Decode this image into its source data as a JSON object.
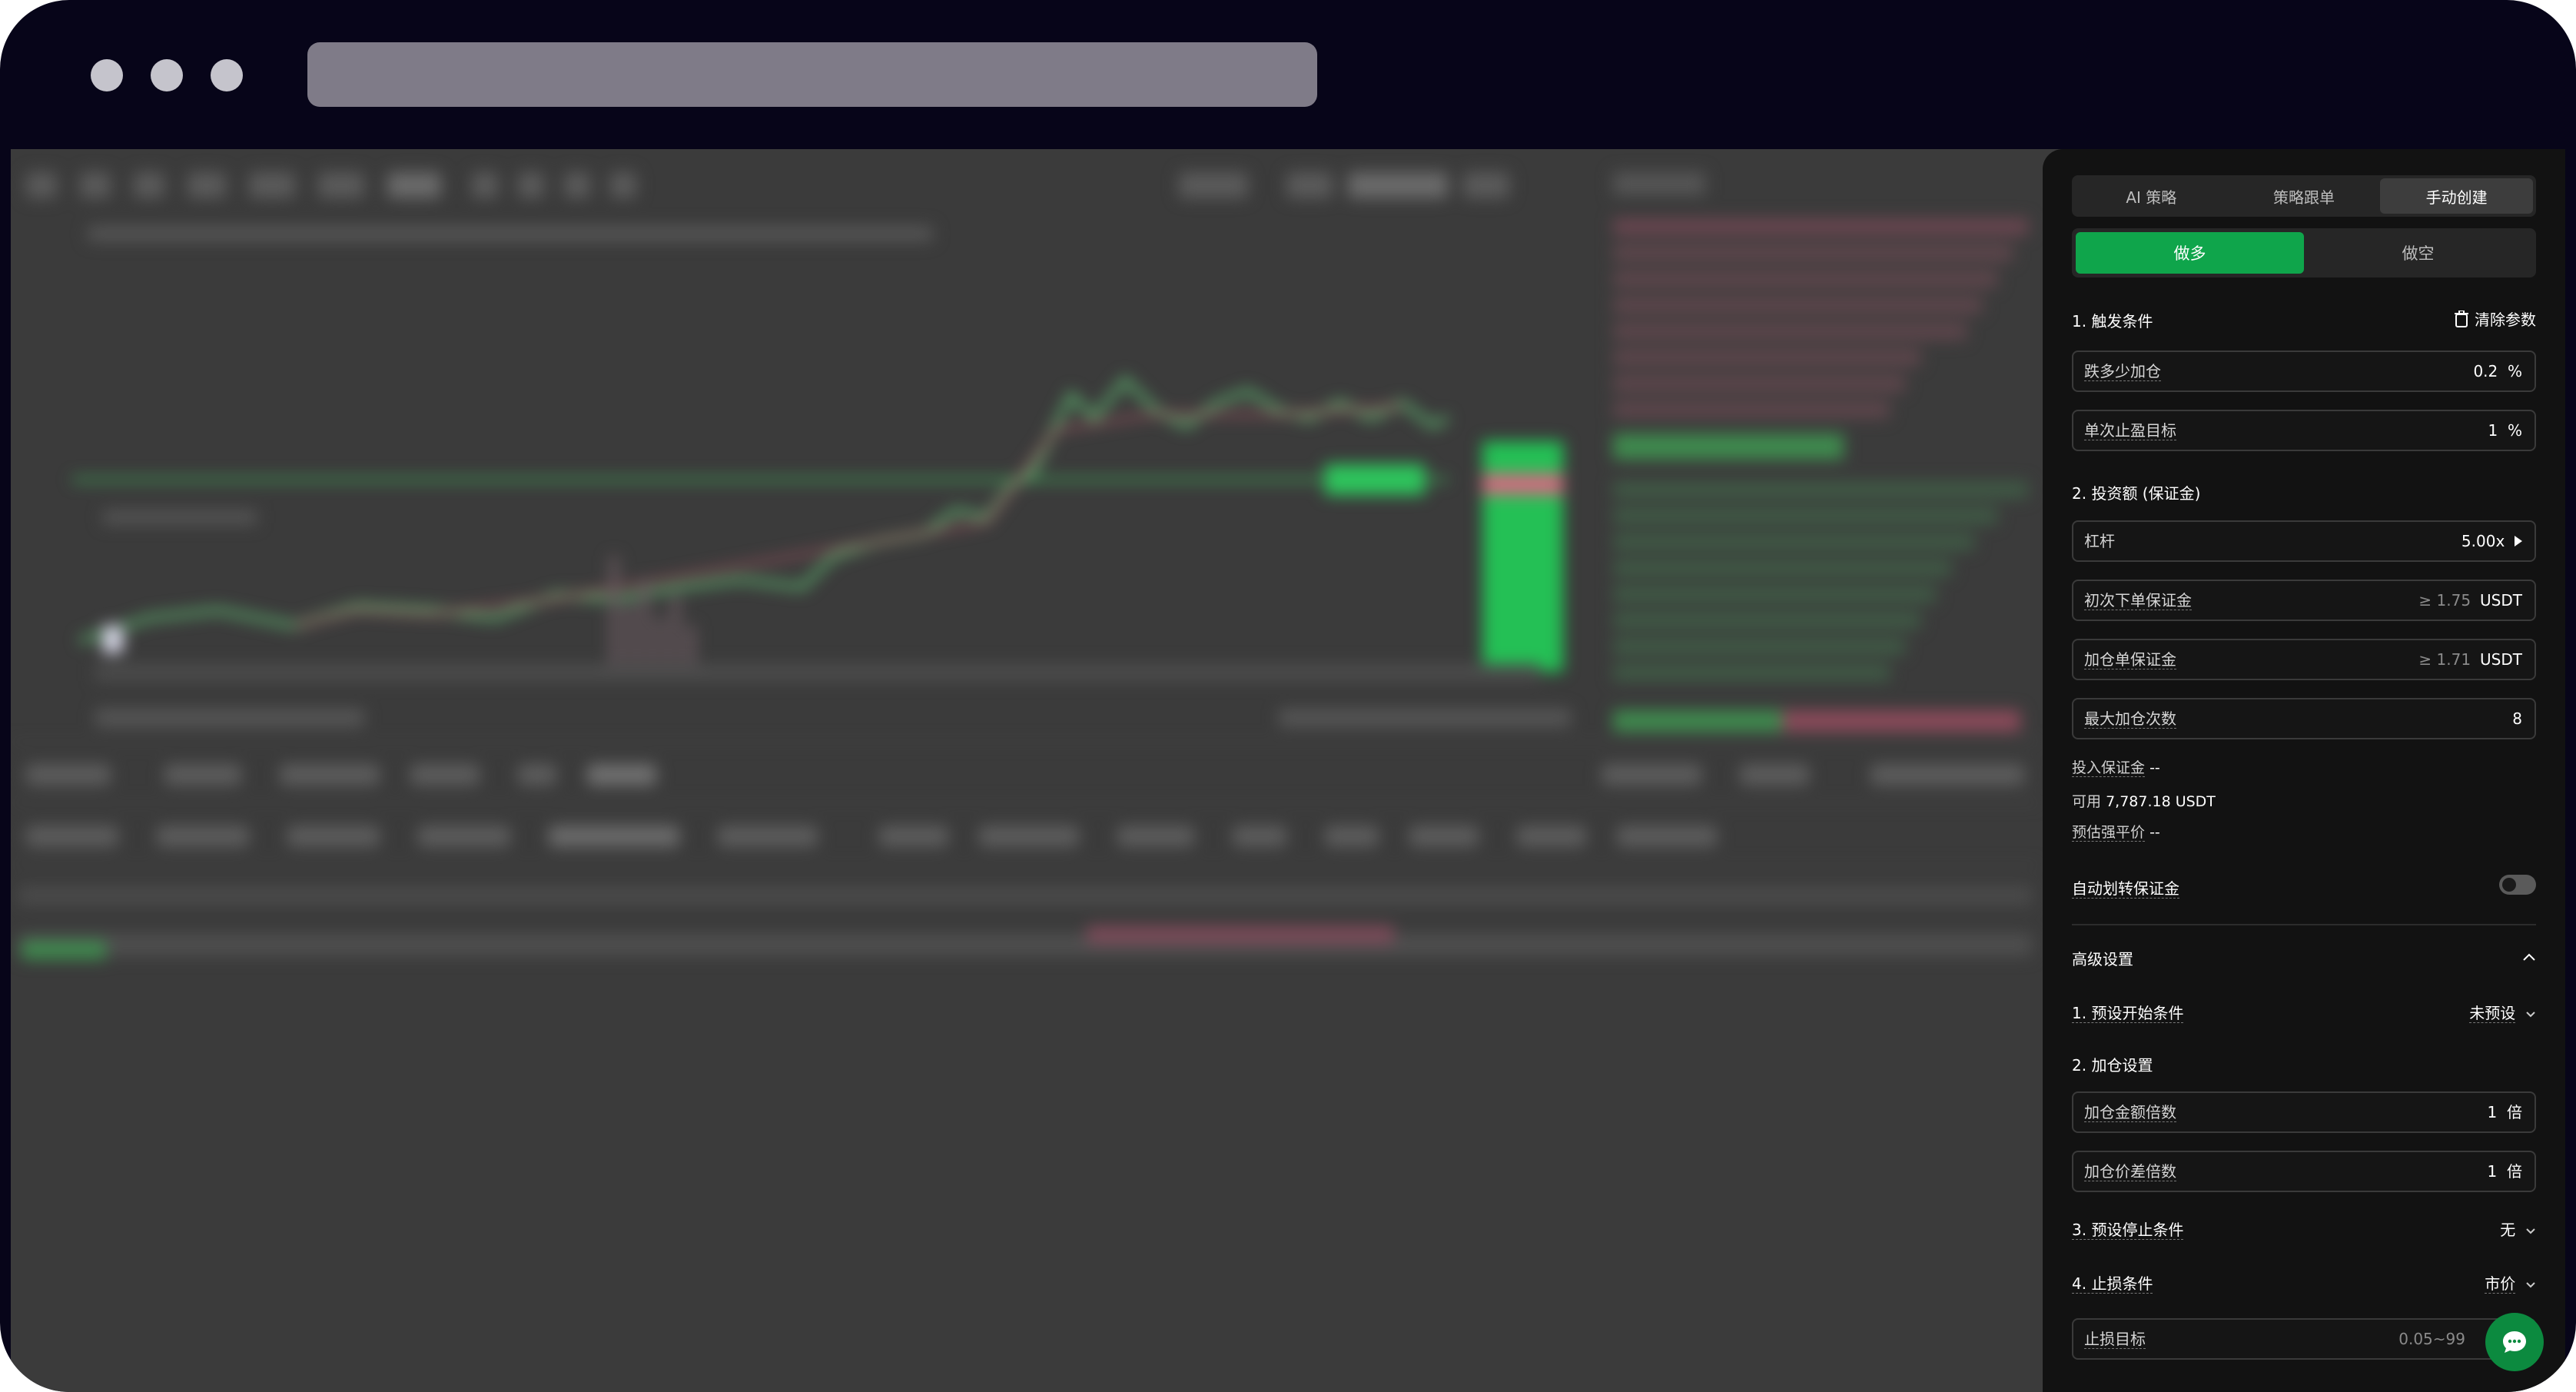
{
  "panel": {
    "mode_tabs": [
      "AI 策略",
      "策略跟单",
      "手动创建"
    ],
    "active_mode_index": 2,
    "direction": {
      "long": "做多",
      "short": "做空",
      "selected": "long"
    },
    "section_trigger": "1. 触发条件",
    "clear_params": "清除参数",
    "drop_add_label": "跌多少加仓",
    "drop_add_value": "0.2",
    "drop_add_unit": "%",
    "tp_label": "单次止盈目标",
    "tp_value": "1",
    "tp_unit": "%",
    "section_invest": "2. 投资额 (保证金)",
    "leverage_label": "杠杆",
    "leverage_value": "5.00x",
    "init_margin_label": "初次下单保证金",
    "init_margin_hint": "≥ 1.75",
    "init_margin_unit": "USDT",
    "add_margin_label": "加仓单保证金",
    "add_margin_hint": "≥ 1.71",
    "add_margin_unit": "USDT",
    "max_add_label": "最大加仓次数",
    "max_add_value": "8",
    "invest_margin_label": "投入保证金",
    "invest_margin_value": "--",
    "available_label": "可用",
    "available_value": "7,787.18 USDT",
    "liq_label": "预估强平价",
    "liq_value": "--",
    "auto_transfer_label": "自动划转保证金",
    "auto_transfer_on": false,
    "advanced_label": "高级设置",
    "preset_start_label": "1. 预设开始条件",
    "preset_start_value": "未预设",
    "add_settings_label": "2. 加仓设置",
    "add_amount_mult_label": "加仓金额倍数",
    "add_amount_mult_value": "1",
    "add_amount_mult_unit": "倍",
    "add_price_mult_label": "加仓价差倍数",
    "add_price_mult_value": "1",
    "add_price_mult_unit": "倍",
    "preset_stop_label": "3. 预设停止条件",
    "preset_stop_value": "无",
    "sl_cond_label": "4. 止损条件",
    "sl_cond_value": "市价",
    "sl_target_label": "止损目标",
    "sl_target_placeholder": "0.05~99"
  },
  "colors": {
    "long_green": "#0fa54b",
    "panel_bg": "#121212",
    "backdrop": "#3b3b3b"
  },
  "icons": [
    "trash-icon",
    "chevron-right-icon",
    "chevron-up-icon",
    "chevron-down-icon",
    "chat-icon"
  ]
}
